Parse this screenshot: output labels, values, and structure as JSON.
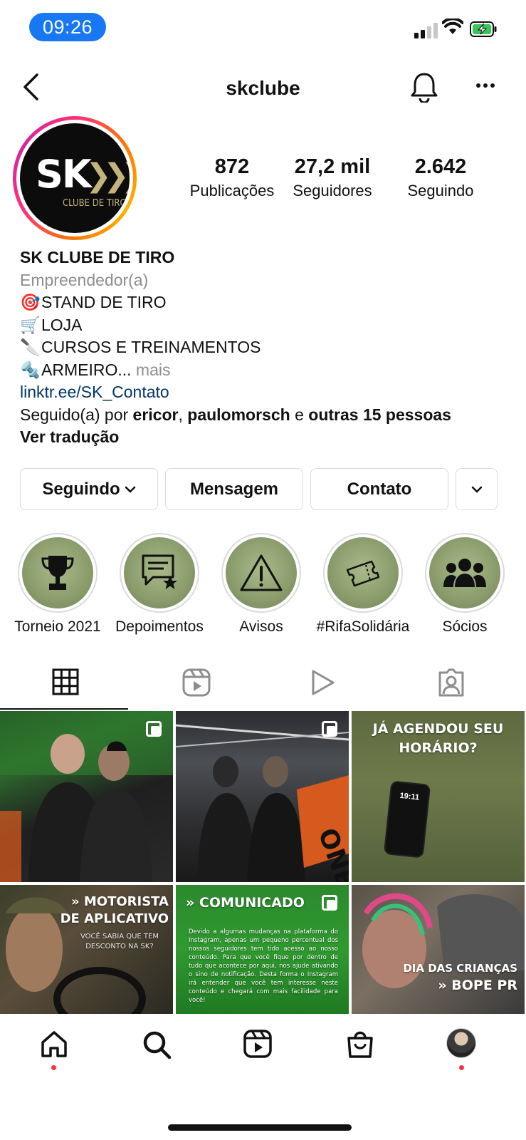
{
  "status_bar": {
    "time": "09:26"
  },
  "header": {
    "username": "skclube"
  },
  "profile": {
    "avatar": {
      "logo_text": "SK",
      "logo_subtext": "CLUBE DE TIRO"
    },
    "stats": [
      {
        "value": "872",
        "label": "Publicações"
      },
      {
        "value": "27,2 mil",
        "label": "Seguidores"
      },
      {
        "value": "2.642",
        "label": "Seguindo"
      }
    ],
    "name": "SK CLUBE DE TIRO",
    "category": "Empreendedor(a)",
    "bio_lines": [
      {
        "emoji": "🎯",
        "text": "STAND DE TIRO"
      },
      {
        "emoji": "🛒",
        "text": "LOJA"
      },
      {
        "emoji": "🔪",
        "text": "CURSOS E TREINAMENTOS"
      },
      {
        "emoji": "🔩",
        "text": "ARMEIRO...",
        "more": "mais"
      }
    ],
    "link": "linktr.ee/SK_Contato",
    "followed_by": {
      "prefix": "Seguido(a) por ",
      "user1": "ericor",
      "sep": ", ",
      "user2": "paulomorsch",
      "and": " e ",
      "others": "outras 15 pessoas"
    },
    "translate": "Ver tradução"
  },
  "actions": {
    "following": "Seguindo",
    "message": "Mensagem",
    "contact": "Contato"
  },
  "highlights": [
    {
      "label": "Torneio 2021",
      "icon": "trophy-icon"
    },
    {
      "label": "Depoimentos",
      "icon": "testimonial-icon"
    },
    {
      "label": "Avisos",
      "icon": "warning-icon"
    },
    {
      "label": "#RifaSolidária",
      "icon": "ticket-icon"
    },
    {
      "label": "Sócios",
      "icon": "group-icon"
    }
  ],
  "tabs": [
    "grid-icon",
    "reels-icon",
    "play-icon",
    "tagged-icon"
  ],
  "posts": {
    "p3_text": "JÁ AGENDOU SEU HORÁRIO?",
    "p3_phone_time": "19:11",
    "p4_title_1": "» MOTORISTA",
    "p4_title_2": "DE APLICATIVO",
    "p4_sub": "VOCÊ SABIA QUE TEM DESCONTO NA SK?",
    "p5_title": "» COMUNICADO",
    "p5_body": "Devido a algumas mudanças na plataforma do Instagram, apenas um pequeno percentual dos nossos seguidores tem tido acesso ao nosso conteúdo. Para que você fique por dentro de tudo que acontece por aqui, nos ajude ativando o sino de notificação. Desta forma o Instagram irá entender que você tem interesse neste conteúdo e chegará com mais facilidade para você!",
    "p6_line1": "DIA DAS CRIANÇAS",
    "p6_line2": "» BOPE PR"
  },
  "colors": {
    "accent_blue": "#1877f2",
    "link": "#00376b",
    "notif_dot": "#ff3040",
    "highlight_green": "#8a9c6c"
  }
}
